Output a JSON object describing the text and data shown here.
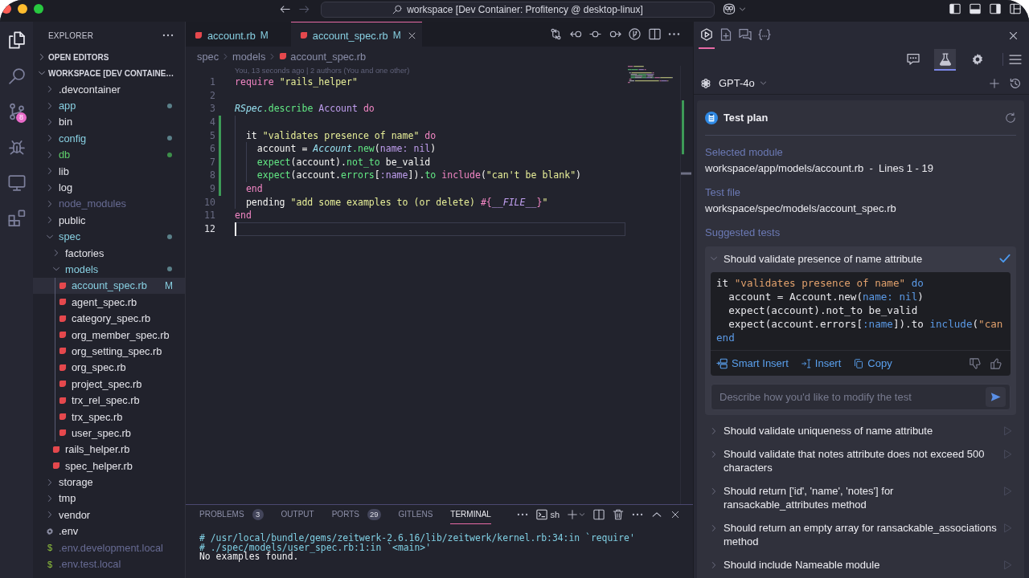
{
  "window": {
    "title": "workspace [Dev Container: Profitency @ desktop-linux]",
    "navigation": [
      {
        "kind": "back",
        "disabled": false
      },
      {
        "kind": "forward",
        "disabled": true
      }
    ]
  },
  "activity_bar": [
    {
      "kind": "explorer",
      "selected": true
    },
    {
      "kind": "search",
      "selected": false
    },
    {
      "kind": "source-control",
      "selected": false,
      "badge": "8"
    },
    {
      "kind": "debug",
      "selected": false
    },
    {
      "kind": "remote",
      "selected": false
    },
    {
      "kind": "extensions",
      "selected": false
    }
  ],
  "explorer": {
    "title": "EXPLORER",
    "sections": [
      {
        "label": "OPEN EDITORS",
        "expanded": false
      },
      {
        "label": "WORKSPACE [DEV CONTAINE…",
        "expanded": true,
        "items": [
          {
            "name": ".devcontainer",
            "kind": "folder",
            "expanded": false,
            "modified": false,
            "untracked": false,
            "ignored": false,
            "selected": false
          },
          {
            "name": "app",
            "kind": "folder",
            "expanded": false,
            "modified": true,
            "untracked": false,
            "ignored": false,
            "selected": false
          },
          {
            "name": "bin",
            "kind": "folder",
            "expanded": false,
            "modified": false,
            "untracked": false,
            "ignored": false,
            "selected": false
          },
          {
            "name": "config",
            "kind": "folder",
            "expanded": false,
            "modified": true,
            "untracked": false,
            "ignored": false,
            "selected": false
          },
          {
            "name": "db",
            "kind": "folder",
            "expanded": false,
            "modified": false,
            "untracked": true,
            "ignored": false,
            "selected": false
          },
          {
            "name": "lib",
            "kind": "folder",
            "expanded": false,
            "modified": false,
            "untracked": false,
            "ignored": false,
            "selected": false
          },
          {
            "name": "log",
            "kind": "folder",
            "expanded": false,
            "modified": false,
            "untracked": false,
            "ignored": false,
            "selected": false
          },
          {
            "name": "node_modules",
            "kind": "folder",
            "expanded": false,
            "modified": false,
            "untracked": false,
            "ignored": true,
            "selected": false
          },
          {
            "name": "public",
            "kind": "folder",
            "expanded": false,
            "modified": false,
            "untracked": false,
            "ignored": false,
            "selected": false
          },
          {
            "name": "spec",
            "kind": "folder",
            "expanded": true,
            "modified": true,
            "untracked": false,
            "ignored": false,
            "selected": false,
            "children": [
              {
                "name": "factories",
                "kind": "folder",
                "expanded": false,
                "modified": false,
                "untracked": false,
                "ignored": false,
                "selected": false
              },
              {
                "name": "models",
                "kind": "folder",
                "expanded": true,
                "modified": true,
                "untracked": false,
                "ignored": false,
                "selected": false,
                "children": [
                  {
                    "name": "account_spec.rb",
                    "kind": "ruby",
                    "modified": true,
                    "untracked": false,
                    "ignored": false,
                    "badge": "M",
                    "selected": true
                  },
                  {
                    "name": "agent_spec.rb",
                    "kind": "ruby",
                    "modified": false,
                    "untracked": false,
                    "ignored": false,
                    "selected": false
                  },
                  {
                    "name": "category_spec.rb",
                    "kind": "ruby",
                    "modified": false,
                    "untracked": false,
                    "ignored": false,
                    "selected": false
                  },
                  {
                    "name": "org_member_spec.rb",
                    "kind": "ruby",
                    "modified": false,
                    "untracked": false,
                    "ignored": false,
                    "selected": false
                  },
                  {
                    "name": "org_setting_spec.rb",
                    "kind": "ruby",
                    "modified": false,
                    "untracked": false,
                    "ignored": false,
                    "selected": false
                  },
                  {
                    "name": "org_spec.rb",
                    "kind": "ruby",
                    "modified": false,
                    "untracked": false,
                    "ignored": false,
                    "selected": false
                  },
                  {
                    "name": "project_spec.rb",
                    "kind": "ruby",
                    "modified": false,
                    "untracked": false,
                    "ignored": false,
                    "selected": false
                  },
                  {
                    "name": "trx_rel_spec.rb",
                    "kind": "ruby",
                    "modified": false,
                    "untracked": false,
                    "ignored": false,
                    "selected": false
                  },
                  {
                    "name": "trx_spec.rb",
                    "kind": "ruby",
                    "modified": false,
                    "untracked": false,
                    "ignored": false,
                    "selected": false
                  },
                  {
                    "name": "user_spec.rb",
                    "kind": "ruby",
                    "modified": false,
                    "untracked": false,
                    "ignored": false,
                    "selected": false
                  }
                ]
              },
              {
                "name": "rails_helper.rb",
                "kind": "ruby",
                "modified": false,
                "untracked": false,
                "ignored": false,
                "selected": false
              },
              {
                "name": "spec_helper.rb",
                "kind": "ruby",
                "modified": false,
                "untracked": false,
                "ignored": false,
                "selected": false
              }
            ]
          },
          {
            "name": "storage",
            "kind": "folder",
            "expanded": false,
            "modified": false,
            "untracked": false,
            "ignored": false,
            "selected": false
          },
          {
            "name": "tmp",
            "kind": "folder",
            "expanded": false,
            "modified": false,
            "untracked": false,
            "ignored": false,
            "selected": false
          },
          {
            "name": "vendor",
            "kind": "folder",
            "expanded": false,
            "modified": false,
            "untracked": false,
            "ignored": false,
            "selected": false
          },
          {
            "name": ".env",
            "kind": "settings",
            "modified": false,
            "untracked": false,
            "ignored": false,
            "selected": false
          },
          {
            "name": ".env.development.local",
            "kind": "dotenv",
            "glyph": "$",
            "modified": false,
            "untracked": false,
            "ignored": true,
            "selected": false
          },
          {
            "name": ".env.test.local",
            "kind": "dotenv",
            "glyph": "$",
            "modified": false,
            "untracked": false,
            "ignored": true,
            "selected": false
          }
        ]
      }
    ]
  },
  "editor": {
    "tabs": [
      {
        "label": "account.rb",
        "badge": "M",
        "modified": true,
        "selected": false
      },
      {
        "label": "account_spec.rb",
        "badge": "M",
        "modified": true,
        "selected": true
      }
    ],
    "breadcrumbs": [
      {
        "label": "spec",
        "kind": "folder"
      },
      {
        "label": "models",
        "kind": "folder"
      },
      {
        "label": "account_spec.rb",
        "kind": "ruby"
      }
    ],
    "blame": "You, 13 seconds ago | 2 authors (You and one other)",
    "lines": [
      {
        "number": "1",
        "added": false,
        "current": false,
        "tokens": [
          {
            "text": "require ",
            "kind": "keyword"
          },
          {
            "text": "\"rails_helper\"",
            "kind": "string"
          }
        ]
      },
      {
        "number": "2",
        "added": false,
        "current": false
      },
      {
        "number": "3",
        "added": false,
        "current": false,
        "tokens": [
          {
            "text": "RSpec",
            "kind": "constant"
          },
          {
            "text": ".describe ",
            "kind": "method"
          },
          {
            "text": "Account ",
            "kind": "class"
          },
          {
            "text": "do",
            "kind": "keyword"
          }
        ]
      },
      {
        "number": "4",
        "added": true,
        "current": false
      },
      {
        "number": "5",
        "added": true,
        "current": false,
        "tokens": [
          {
            "text": "  it ",
            "kind": "plain"
          },
          {
            "text": "\"validates presence of name\" ",
            "kind": "string"
          },
          {
            "text": "do",
            "kind": "keyword"
          }
        ]
      },
      {
        "number": "6",
        "added": true,
        "current": false,
        "tokens": [
          {
            "text": "    account = ",
            "kind": "plain"
          },
          {
            "text": "Account",
            "kind": "constant"
          },
          {
            "text": ".new",
            "kind": "method"
          },
          {
            "text": "(",
            "kind": "plain"
          },
          {
            "text": "name: nil",
            "kind": "symbol"
          },
          {
            "text": ")",
            "kind": "plain"
          }
        ]
      },
      {
        "number": "7",
        "added": true,
        "current": false,
        "tokens": [
          {
            "text": "    expect",
            "kind": "method"
          },
          {
            "text": "(account).",
            "kind": "plain"
          },
          {
            "text": "not_to",
            "kind": "method"
          },
          {
            "text": " be_valid",
            "kind": "plain"
          }
        ]
      },
      {
        "number": "8",
        "added": true,
        "current": false,
        "tokens": [
          {
            "text": "    expect",
            "kind": "method"
          },
          {
            "text": "(account.",
            "kind": "plain"
          },
          {
            "text": "errors",
            "kind": "method"
          },
          {
            "text": "[",
            "kind": "plain"
          },
          {
            "text": ":name",
            "kind": "symbol"
          },
          {
            "text": "]).",
            "kind": "plain"
          },
          {
            "text": "to ",
            "kind": "method"
          },
          {
            "text": "include",
            "kind": "keyword"
          },
          {
            "text": "(",
            "kind": "plain"
          },
          {
            "text": "\"can't be blank\"",
            "kind": "string"
          },
          {
            "text": ")",
            "kind": "plain"
          }
        ]
      },
      {
        "number": "9",
        "added": true,
        "current": false,
        "tokens": [
          {
            "text": "  end",
            "kind": "keyword"
          }
        ]
      },
      {
        "number": "10",
        "added": false,
        "current": false,
        "tokens": [
          {
            "text": "  pending ",
            "kind": "plain"
          },
          {
            "text": "\"add some examples to (or delete) ",
            "kind": "string"
          },
          {
            "text": "#{",
            "kind": "keyword"
          },
          {
            "text": "__FILE__",
            "kind": "special"
          },
          {
            "text": "}",
            "kind": "keyword"
          },
          {
            "text": "\"",
            "kind": "string"
          }
        ]
      },
      {
        "number": "11",
        "added": false,
        "current": false,
        "tokens": [
          {
            "text": "end",
            "kind": "keyword"
          }
        ]
      },
      {
        "number": "12",
        "added": false,
        "current": true
      }
    ]
  },
  "panel": {
    "tabs": [
      {
        "label": "PROBLEMS",
        "count": "3",
        "selected": false
      },
      {
        "label": "OUTPUT",
        "selected": false
      },
      {
        "label": "PORTS",
        "count": "29",
        "selected": false
      },
      {
        "label": "GITLENS",
        "selected": false
      },
      {
        "label": "TERMINAL",
        "selected": true
      }
    ],
    "shell": "sh",
    "terminal": [
      {
        "text": "# /usr/local/bundle/gems/zeitwerk-2.6.16/lib/zeitwerk/kernel.rb:34:in `require'",
        "kind": "trace"
      },
      {
        "text": "# ./spec/models/user_spec.rb:1:in `<main>'",
        "kind": "trace"
      },
      {
        "text": "No examples found.",
        "kind": "message"
      }
    ]
  },
  "assistant": {
    "view_tabs": [
      {
        "kind": "logo",
        "selected": true
      },
      {
        "kind": "new-file",
        "selected": false
      },
      {
        "kind": "chats",
        "selected": false
      },
      {
        "kind": "context",
        "selected": false
      }
    ],
    "mode_tabs": [
      {
        "kind": "chat",
        "selected": false
      },
      {
        "kind": "tests",
        "selected": true
      },
      {
        "kind": "settings",
        "selected": false
      }
    ],
    "model": "GPT-4o",
    "test_plan": {
      "title": "Test plan",
      "fields": [
        {
          "label": "Selected module",
          "value": "workspace/app/models/account.rb  -  Lines 1 - 19"
        },
        {
          "label": "Test file",
          "value": "workspace/spec/models/account_spec.rb"
        }
      ],
      "suggested_label": "Suggested tests",
      "tests": [
        {
          "title": "Should validate presence of name attribute",
          "expanded": true,
          "inserted": true,
          "code": [
            {
              "tokens": [
                {
                  "text": "it ",
                  "kind": "plain"
                },
                {
                  "text": "\"validates presence of name\" ",
                  "kind": "string"
                },
                {
                  "text": "do",
                  "kind": "keyword"
                }
              ]
            },
            {
              "tokens": [
                {
                  "text": "  account = Account.new(",
                  "kind": "plain"
                },
                {
                  "text": "name: nil",
                  "kind": "symbol"
                },
                {
                  "text": ")",
                  "kind": "plain"
                }
              ]
            },
            {
              "tokens": [
                {
                  "text": "  expect(account).not_to be_valid",
                  "kind": "plain"
                }
              ]
            },
            {
              "tokens": [
                {
                  "text": "  expect(account.errors[",
                  "kind": "plain"
                },
                {
                  "text": ":name",
                  "kind": "symbol"
                },
                {
                  "text": "]).to ",
                  "kind": "plain"
                },
                {
                  "text": "include",
                  "kind": "keyword"
                },
                {
                  "text": "(",
                  "kind": "plain"
                },
                {
                  "text": "\"can",
                  "kind": "string"
                }
              ]
            },
            {
              "tokens": [
                {
                  "text": "end",
                  "kind": "keyword"
                }
              ]
            }
          ],
          "actions": [
            {
              "kind": "smart-insert",
              "label": "Smart Insert"
            },
            {
              "kind": "insert",
              "label": "Insert"
            },
            {
              "kind": "copy",
              "label": "Copy"
            }
          ],
          "prompt": {
            "placeholder": "Describe how you'd like to modify the test"
          }
        },
        {
          "title": "Should validate uniqueness of name attribute",
          "expanded": false,
          "inserted": false
        },
        {
          "title": "Should validate that notes attribute does not exceed 500 characters",
          "expanded": false,
          "inserted": false
        },
        {
          "title": "Should return ['id', 'name', 'notes'] for ransackable_attributes method",
          "expanded": false,
          "inserted": false
        },
        {
          "title": "Should return an empty array for ransackable_associations method",
          "expanded": false,
          "inserted": false
        },
        {
          "title": "Should include Nameable module",
          "expanded": false,
          "inserted": false
        }
      ]
    }
  }
}
